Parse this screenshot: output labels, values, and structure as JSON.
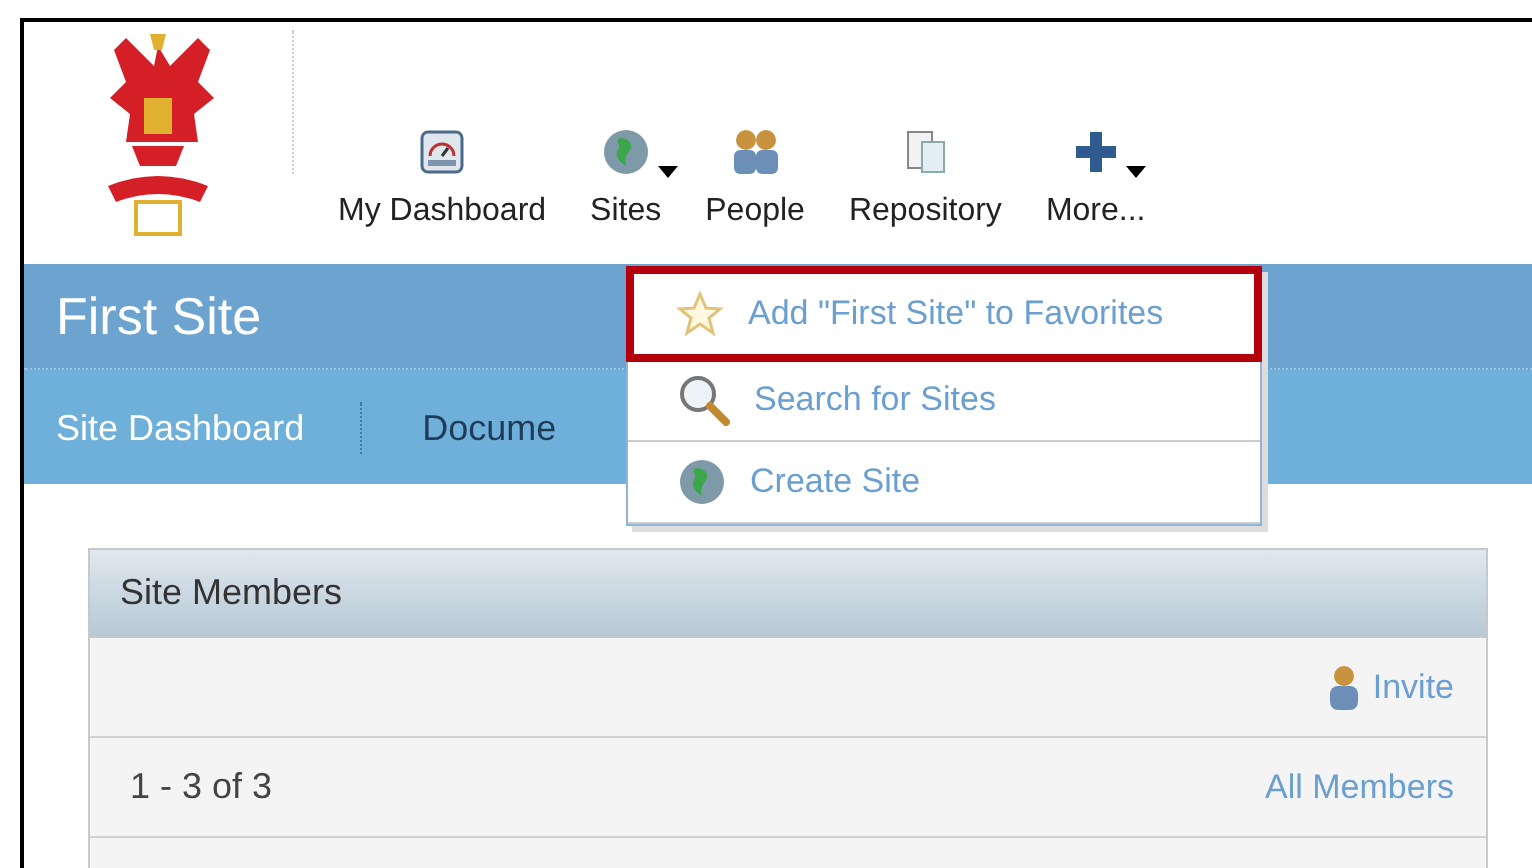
{
  "toolbar": [
    {
      "label": "My Dashboard",
      "has_menu": false
    },
    {
      "label": "Sites",
      "has_menu": true
    },
    {
      "label": "People",
      "has_menu": false
    },
    {
      "label": "Repository",
      "has_menu": false
    },
    {
      "label": "More...",
      "has_menu": true
    }
  ],
  "site_title": "First Site",
  "site_nav": [
    {
      "label": "Site Dashboard",
      "selected": false
    },
    {
      "label": "Docume",
      "selected": true
    }
  ],
  "sites_menu": [
    {
      "label": "Add \"First Site\" to Favorites",
      "highlighted": true
    },
    {
      "label": "Search for Sites",
      "highlighted": false
    },
    {
      "label": "Create Site",
      "highlighted": false
    }
  ],
  "dashlet": {
    "title": "Site Members",
    "invite": "Invite",
    "count": "1 - 3 of 3",
    "all_members": "All Members"
  }
}
